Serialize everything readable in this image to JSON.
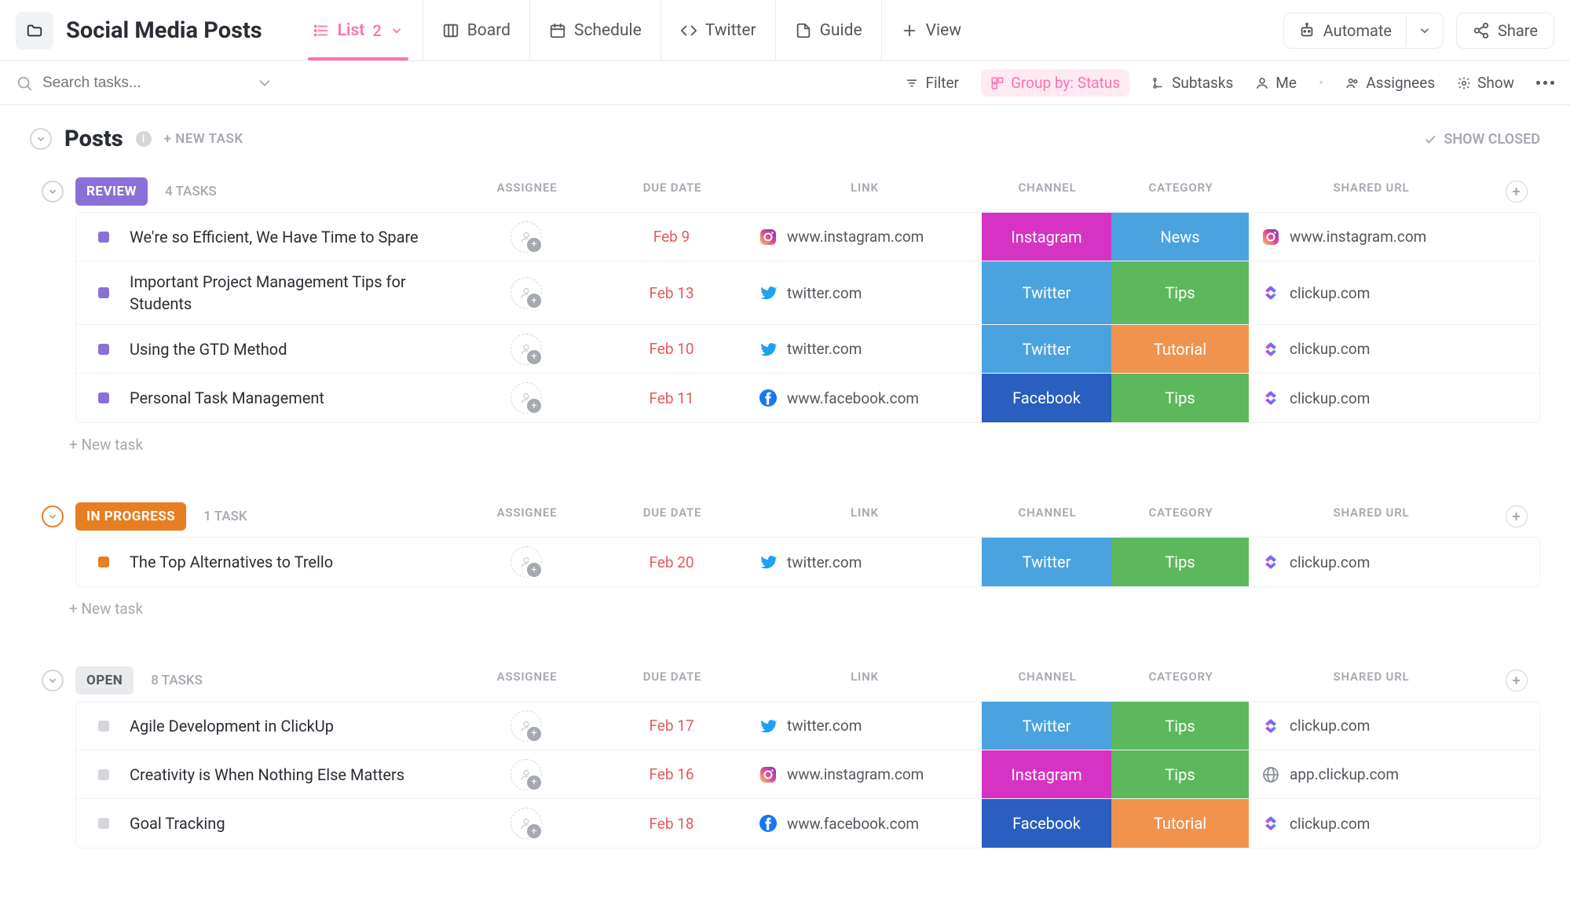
{
  "header": {
    "title": "Social Media Posts",
    "tabs": [
      {
        "label": "List",
        "badge": "2",
        "icon": "list"
      },
      {
        "label": "Board",
        "icon": "board"
      },
      {
        "label": "Schedule",
        "icon": "calendar"
      },
      {
        "label": "Twitter",
        "icon": "code"
      },
      {
        "label": "Guide",
        "icon": "doc"
      },
      {
        "label": "View",
        "icon": "plus"
      }
    ],
    "automate": "Automate",
    "share": "Share"
  },
  "toolbar": {
    "search_placeholder": "Search tasks...",
    "filter": "Filter",
    "group_by": "Group by: Status",
    "subtasks": "Subtasks",
    "me": "Me",
    "assignees": "Assignees",
    "show": "Show"
  },
  "posts": {
    "title": "Posts",
    "new_task": "+ NEW TASK",
    "show_closed": "SHOW CLOSED"
  },
  "columns": {
    "assignee": "ASSIGNEE",
    "due_date": "DUE DATE",
    "link": "LINK",
    "channel": "CHANNEL",
    "category": "CATEGORY",
    "shared_url": "SHARED URL"
  },
  "new_task_row": "+ New task",
  "groups": [
    {
      "status": "REVIEW",
      "status_color": "#8a70d6",
      "status_bg": "#8a70d6",
      "status_fg": "#ffffff",
      "count": "4 TASKS",
      "tasks": [
        {
          "title": "We're so Efficient, We Have Time to Spare",
          "due": "Feb 9",
          "link_site": "instagram",
          "link": "www.instagram.com",
          "channel": "Instagram",
          "channel_color": "#d633c4",
          "category": "News",
          "category_color": "#4aa3df",
          "shared_site": "instagram",
          "shared": "www.instagram.com"
        },
        {
          "title": "Important Project Management Tips for Students",
          "due": "Feb 13",
          "link_site": "twitter",
          "link": "twitter.com",
          "channel": "Twitter",
          "channel_color": "#4aa3df",
          "category": "Tips",
          "category_color": "#5cb85c",
          "shared_site": "clickup",
          "shared": "clickup.com"
        },
        {
          "title": "Using the GTD Method",
          "due": "Feb 10",
          "link_site": "twitter",
          "link": "twitter.com",
          "channel": "Twitter",
          "channel_color": "#4aa3df",
          "category": "Tutorial",
          "category_color": "#f0934e",
          "shared_site": "clickup",
          "shared": "clickup.com"
        },
        {
          "title": "Personal Task Management",
          "due": "Feb 11",
          "link_site": "facebook",
          "link": "www.facebook.com",
          "channel": "Facebook",
          "channel_color": "#2a5ebf",
          "category": "Tips",
          "category_color": "#5cb85c",
          "shared_site": "clickup",
          "shared": "clickup.com"
        }
      ]
    },
    {
      "status": "IN PROGRESS",
      "status_color": "#e67e22",
      "status_bg": "#e67e22",
      "status_fg": "#ffffff",
      "count": "1 TASK",
      "tasks": [
        {
          "title": "The Top Alternatives to Trello",
          "due": "Feb 20",
          "link_site": "twitter",
          "link": "twitter.com",
          "channel": "Twitter",
          "channel_color": "#4aa3df",
          "category": "Tips",
          "category_color": "#5cb85c",
          "shared_site": "clickup",
          "shared": "clickup.com"
        }
      ]
    },
    {
      "status": "OPEN",
      "status_color": "#d4d6da",
      "status_bg": "#e8eaed",
      "status_fg": "#54575d",
      "count": "8 TASKS",
      "tasks": [
        {
          "title": "Agile Development in ClickUp",
          "due": "Feb 17",
          "link_site": "twitter",
          "link": "twitter.com",
          "channel": "Twitter",
          "channel_color": "#4aa3df",
          "category": "Tips",
          "category_color": "#5cb85c",
          "shared_site": "clickup",
          "shared": "clickup.com"
        },
        {
          "title": "Creativity is When Nothing Else Matters",
          "due": "Feb 16",
          "link_site": "instagram",
          "link": "www.instagram.com",
          "channel": "Instagram",
          "channel_color": "#d633c4",
          "category": "Tips",
          "category_color": "#5cb85c",
          "shared_site": "globe",
          "shared": "app.clickup.com"
        },
        {
          "title": "Goal Tracking",
          "due": "Feb 18",
          "link_site": "facebook",
          "link": "www.facebook.com",
          "channel": "Facebook",
          "channel_color": "#2a5ebf",
          "category": "Tutorial",
          "category_color": "#f0934e",
          "shared_site": "clickup",
          "shared": "clickup.com"
        }
      ]
    }
  ]
}
